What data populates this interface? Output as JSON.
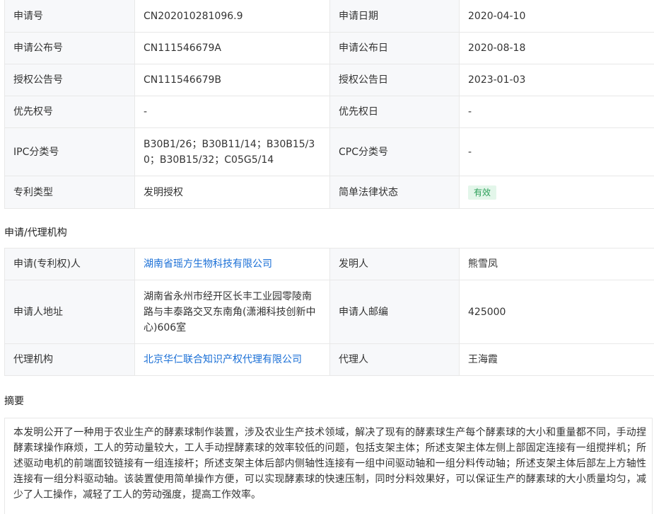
{
  "basic_info": {
    "rows": [
      {
        "l1": "申请号",
        "v1": "CN202010281096.9",
        "l2": "申请日期",
        "v2": "2020-04-10"
      },
      {
        "l1": "申请公布号",
        "v1": "CN111546679A",
        "l2": "申请公布日",
        "v2": "2020-08-18"
      },
      {
        "l1": "授权公告号",
        "v1": "CN111546679B",
        "l2": "授权公告日",
        "v2": "2023-01-03"
      },
      {
        "l1": "优先权号",
        "v1": "-",
        "l2": "优先权日",
        "v2": "-"
      },
      {
        "l1": "IPC分类号",
        "v1": "B30B1/26；B30B11/14；B30B15/30；B30B15/32；C05G5/14",
        "l2": "CPC分类号",
        "v2": "-"
      },
      {
        "l1": "专利类型",
        "v1": "发明授权",
        "l2": "简单法律状态",
        "v2": "有效"
      }
    ]
  },
  "agency_section": {
    "title": "申请/代理机构",
    "rows": [
      {
        "l1": "申请(专利权)人",
        "v1": "湖南省瑶方生物科技有限公司",
        "l2": "发明人",
        "v2": "熊雪凤"
      },
      {
        "l1": "申请人地址",
        "v1": "湖南省永州市经开区长丰工业园零陵南路与丰泰路交叉东南角(潇湘科技创新中心)606室",
        "l2": "申请人邮编",
        "v2": "425000"
      },
      {
        "l1": "代理机构",
        "v1": "北京华仁联合知识产权代理有限公司",
        "l2": "代理人",
        "v2": "王海霞"
      }
    ]
  },
  "abstract_section": {
    "title": "摘要",
    "text": "本发明公开了一种用于农业生产的酵素球制作装置，涉及农业生产技术领域，解决了现有的酵素球生产每个酵素球的大小和重量都不同，手动捏酵素球操作麻烦，工人的劳动量较大，工人手动捏酵素球的效率较低的问题，包括支架主体；所述支架主体左侧上部固定连接有一组搅拌机；所述驱动电机的前端面铰链接有一组连接杆；所述支架主体后部内侧轴性连接有一组中间驱动轴和一组分料传动轴；所述支架主体后部左上方轴性连接有一组分料驱动轴。该装置使用简单操作方便，可以实现酵素球的快速压制，同时分料效果好，可以保证生产的酵素球的大小质量均匀，减少了人工操作，减轻了工人的劳动强度，提高工作效率。"
  },
  "colors": {
    "label_bg": "#f7f8fa",
    "border": "#e8e8e8",
    "link": "#1a6fd6",
    "badge_bg": "#e3f6ea",
    "badge_text": "#2a9e57"
  }
}
